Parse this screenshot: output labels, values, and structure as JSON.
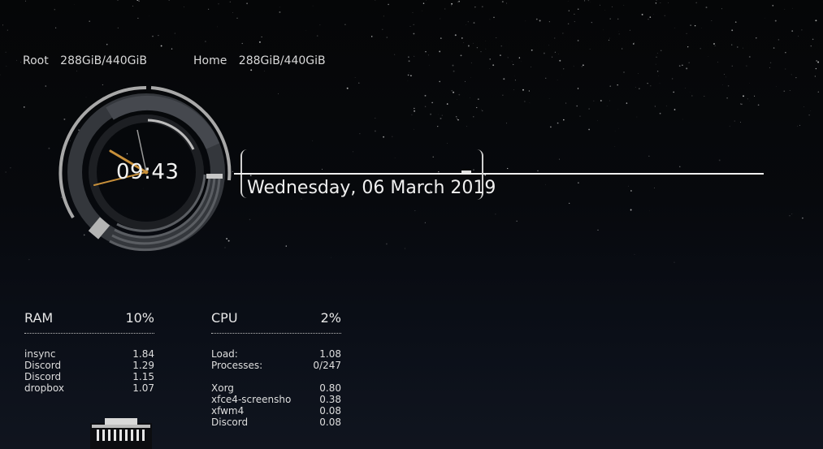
{
  "disks": {
    "root": {
      "label": "Root",
      "value": "288GiB/440GiB"
    },
    "home": {
      "label": "Home",
      "value": "288GiB/440GiB"
    }
  },
  "clock": {
    "time": "09:43"
  },
  "date": "Wednesday, 06 March 2019",
  "ram": {
    "title": "RAM",
    "percent": "10%",
    "processes": [
      {
        "name": "insync",
        "value": "1.84"
      },
      {
        "name": "Discord",
        "value": "1.29"
      },
      {
        "name": "Discord",
        "value": "1.15"
      },
      {
        "name": "dropbox",
        "value": "1.07"
      }
    ]
  },
  "cpu": {
    "title": "CPU",
    "percent": "2%",
    "load_label": "Load:",
    "load_value": "1.08",
    "processes_label": "Processes:",
    "processes_value": "0/247",
    "top": [
      {
        "name": "Xorg",
        "value": "0.80"
      },
      {
        "name": "xfce4-screensho",
        "value": "0.38"
      },
      {
        "name": "xfwm4",
        "value": "0.08"
      },
      {
        "name": "Discord",
        "value": "0.08"
      }
    ]
  },
  "colors": {
    "accent": "#c8903a",
    "ring": "#9a9a9a",
    "ring_dark": "#3a3d42",
    "text": "#e6e6e6"
  },
  "icons": {
    "building": "building-icon"
  }
}
